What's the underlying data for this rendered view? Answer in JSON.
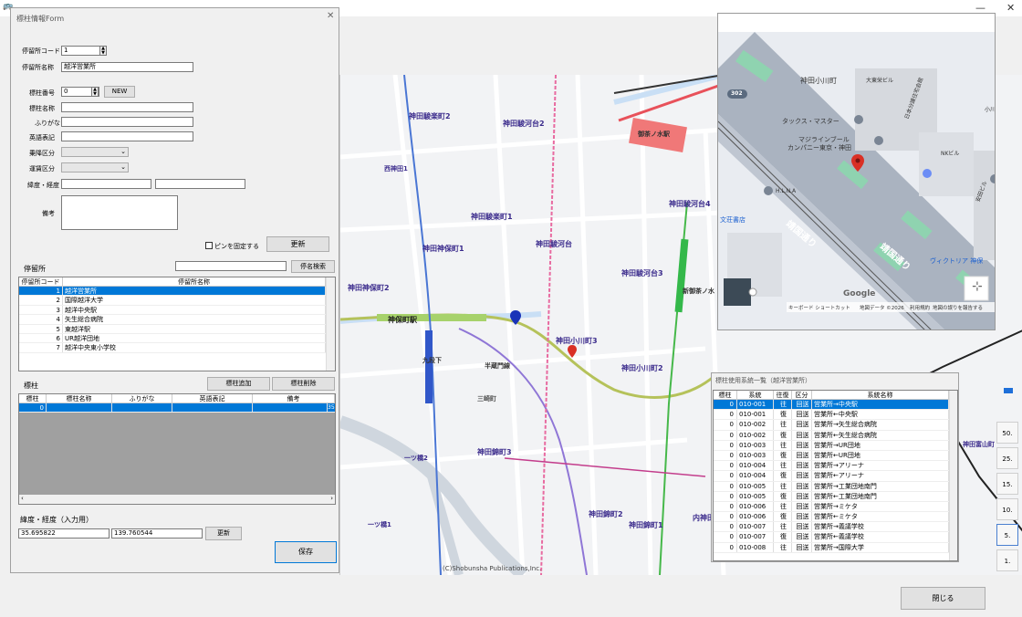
{
  "app": {
    "close_label": "閉じる"
  },
  "window_controls": {
    "minimize": "—",
    "close": "✕"
  },
  "form": {
    "title": "標柱情報Form",
    "stop_code_label": "停留所コード",
    "stop_code_value": "1",
    "stop_name_label": "停留所名称",
    "stop_name_value": "越洋営業所",
    "pole_no_label": "標柱番号",
    "pole_no_value": "0",
    "new_button": "NEW",
    "pole_name_label": "標柱名称",
    "furigana_label": "ふりがな",
    "english_label": "英語表記",
    "route_class_label": "乗降区分",
    "fare_class_label": "運賃区分",
    "latlng_label": "緯度・経度",
    "note_label": "備考",
    "pin_fix_label": "ピンを固定する",
    "update_button": "更新"
  },
  "stops": {
    "group_label": "停留所",
    "search_button": "停名検索",
    "columns": [
      "停留所コード",
      "停留所名称"
    ],
    "rows": [
      {
        "code": "1",
        "name": "越洋営業所"
      },
      {
        "code": "2",
        "name": "国際越洋大学"
      },
      {
        "code": "3",
        "name": "越洋中央駅"
      },
      {
        "code": "4",
        "name": "矢生総合病院"
      },
      {
        "code": "5",
        "name": "東越洋駅"
      },
      {
        "code": "6",
        "name": "UR越洋団地"
      },
      {
        "code": "7",
        "name": "越洋中央東小学校"
      }
    ]
  },
  "poles": {
    "group_label": "標柱",
    "add_button": "標柱追加",
    "delete_button": "標柱削除",
    "columns": [
      "標柱",
      "標柱名称",
      "ふりがな",
      "英語表記",
      "備考"
    ],
    "rows": [
      {
        "no": "0",
        "name": "",
        "kana": "",
        "en": "",
        "note": "",
        "trail": "35"
      }
    ]
  },
  "coords": {
    "group_label": "緯度・経度（入力用）",
    "lat": "35.695822",
    "lng": "139.760544",
    "update_button": "更新",
    "save_button": "保存"
  },
  "route_list": {
    "title": "標柱使用系統一覧（越洋営業所）",
    "columns": [
      "標柱",
      "系統",
      "往復",
      "区分",
      "系統名称"
    ],
    "rows": [
      {
        "pole": "0",
        "route": "010-001",
        "dir": "往",
        "kind": "回送",
        "name": "営業所→中央駅"
      },
      {
        "pole": "0",
        "route": "010-001",
        "dir": "復",
        "kind": "回送",
        "name": "営業所←中央駅"
      },
      {
        "pole": "0",
        "route": "010-002",
        "dir": "往",
        "kind": "回送",
        "name": "営業所→矢生総合病院"
      },
      {
        "pole": "0",
        "route": "010-002",
        "dir": "復",
        "kind": "回送",
        "name": "営業所←矢生総合病院"
      },
      {
        "pole": "0",
        "route": "010-003",
        "dir": "往",
        "kind": "回送",
        "name": "営業所→UR団地"
      },
      {
        "pole": "0",
        "route": "010-003",
        "dir": "復",
        "kind": "回送",
        "name": "営業所←UR団地"
      },
      {
        "pole": "0",
        "route": "010-004",
        "dir": "往",
        "kind": "回送",
        "name": "営業所→アリーナ"
      },
      {
        "pole": "0",
        "route": "010-004",
        "dir": "復",
        "kind": "回送",
        "name": "営業所←アリーナ"
      },
      {
        "pole": "0",
        "route": "010-005",
        "dir": "往",
        "kind": "回送",
        "name": "営業所→工業団地南門"
      },
      {
        "pole": "0",
        "route": "010-005",
        "dir": "復",
        "kind": "回送",
        "name": "営業所←工業団地南門"
      },
      {
        "pole": "0",
        "route": "010-006",
        "dir": "往",
        "kind": "回送",
        "name": "営業所→ミケタ"
      },
      {
        "pole": "0",
        "route": "010-006",
        "dir": "復",
        "kind": "回送",
        "name": "営業所←ミケタ"
      },
      {
        "pole": "0",
        "route": "010-007",
        "dir": "往",
        "kind": "回送",
        "name": "営業所→義議学校"
      },
      {
        "pole": "0",
        "route": "010-007",
        "dir": "復",
        "kind": "回送",
        "name": "営業所←義議学校"
      },
      {
        "pole": "0",
        "route": "010-008",
        "dir": "往",
        "kind": "回送",
        "name": "営業所→国際大学"
      }
    ]
  },
  "map": {
    "copyright": "(C)Shobunsha Publications,Inc.",
    "labels": [
      {
        "text": "神田駿楽町2"
      },
      {
        "text": "神田駿河台2"
      },
      {
        "text": "神田駿河台4"
      },
      {
        "text": "神田駿楽町1"
      },
      {
        "text": "神田駿河台"
      },
      {
        "text": "神田神保町2"
      },
      {
        "text": "神田駿河台3"
      },
      {
        "text": "神田神保町1"
      },
      {
        "text": "神田小川町3"
      },
      {
        "text": "神田小川町2"
      },
      {
        "text": "神田錦町3"
      },
      {
        "text": "神田錦町2"
      },
      {
        "text": "神田錦町1"
      },
      {
        "text": "神保町駅"
      },
      {
        "text": "御茶ノ水駅"
      },
      {
        "text": "九段下"
      },
      {
        "text": "半蔵門線"
      },
      {
        "text": "新御茶ノ水"
      },
      {
        "text": "内神田"
      },
      {
        "text": "一ツ橋2"
      },
      {
        "text": "一ツ橋1"
      },
      {
        "text": "三崎町"
      },
      {
        "text": "西神田1"
      },
      {
        "text": "神田富山町"
      }
    ]
  },
  "streetview": {
    "labels": [
      "神田小川町",
      "大東栄ビル",
      "タックス・マスター",
      "マジラインブール",
      "カンパニー東京・神田",
      "日本分譲住宅会館",
      "NKビル",
      "H.L.N.A",
      "文荘書店",
      "靖国通り",
      "靖国通り",
      "ヴィクトリア 神保",
      "安田ビル",
      "小川",
      "302"
    ],
    "footer": [
      "キーボード ショートカット",
      "地図データ ©2026",
      "利用規約",
      "地図の誤りを報告する"
    ],
    "google": "Google"
  },
  "zoom": [
    "50.",
    "25.",
    "15.",
    "10.",
    "5.",
    "1."
  ],
  "colors": {
    "selection": "#0078d7",
    "pin_red": "#d93025",
    "pin_blue": "#1a33b8",
    "road_green": "#7ac143",
    "jr_red": "#e8515a"
  }
}
